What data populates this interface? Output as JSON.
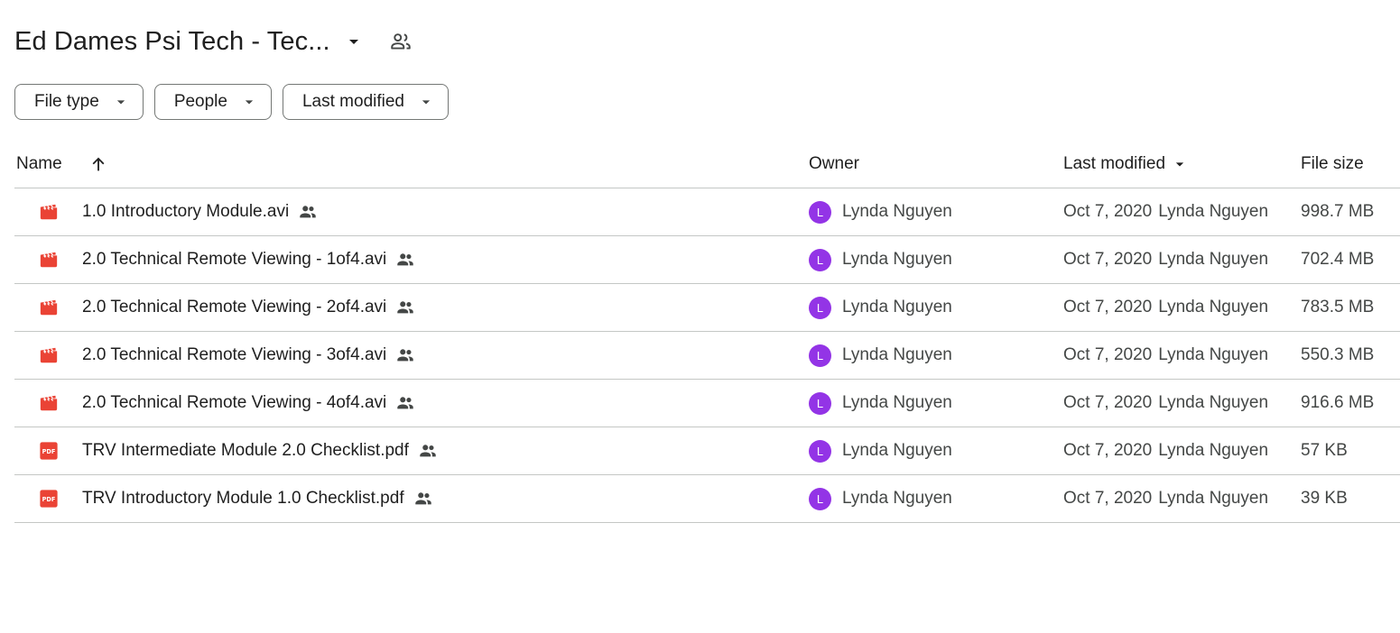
{
  "header": {
    "title": "Ed Dames Psi Tech - Tec...",
    "title_dropdown_icon": "arrow-drop-down-icon",
    "shared_icon": "people-outline-icon"
  },
  "filters": [
    {
      "label": "File type"
    },
    {
      "label": "People"
    },
    {
      "label": "Last modified"
    }
  ],
  "table": {
    "columns": {
      "name": "Name",
      "owner": "Owner",
      "last_modified": "Last modified",
      "file_size": "File size"
    },
    "sort": {
      "name_icon": "arrow-up-icon",
      "modified_icon": "arrow-drop-down-icon"
    },
    "rows": [
      {
        "type": "video",
        "name": "1.0 Introductory Module.avi",
        "owner": "Lynda Nguyen",
        "owner_initial": "L",
        "date": "Oct 7, 2020",
        "modified_by": "Lynda Nguyen",
        "size": "998.7 MB"
      },
      {
        "type": "video",
        "name": "2.0 Technical Remote Viewing - 1of4.avi",
        "owner": "Lynda Nguyen",
        "owner_initial": "L",
        "date": "Oct 7, 2020",
        "modified_by": "Lynda Nguyen",
        "size": "702.4 MB"
      },
      {
        "type": "video",
        "name": "2.0 Technical Remote Viewing - 2of4.avi",
        "owner": "Lynda Nguyen",
        "owner_initial": "L",
        "date": "Oct 7, 2020",
        "modified_by": "Lynda Nguyen",
        "size": "783.5 MB"
      },
      {
        "type": "video",
        "name": "2.0 Technical Remote Viewing - 3of4.avi",
        "owner": "Lynda Nguyen",
        "owner_initial": "L",
        "date": "Oct 7, 2020",
        "modified_by": "Lynda Nguyen",
        "size": "550.3 MB"
      },
      {
        "type": "video",
        "name": "2.0 Technical Remote Viewing - 4of4.avi",
        "owner": "Lynda Nguyen",
        "owner_initial": "L",
        "date": "Oct 7, 2020",
        "modified_by": "Lynda Nguyen",
        "size": "916.6 MB"
      },
      {
        "type": "pdf",
        "name": "TRV Intermediate Module 2.0 Checklist.pdf",
        "owner": "Lynda Nguyen",
        "owner_initial": "L",
        "date": "Oct 7, 2020",
        "modified_by": "Lynda Nguyen",
        "size": "57 KB"
      },
      {
        "type": "pdf",
        "name": "TRV Introductory Module 1.0 Checklist.pdf",
        "owner": "Lynda Nguyen",
        "owner_initial": "L",
        "date": "Oct 7, 2020",
        "modified_by": "Lynda Nguyen",
        "size": "39 KB"
      }
    ]
  },
  "colors": {
    "video_icon": "#ea4335",
    "pdf_icon": "#ea4335",
    "avatar": "#9334e6",
    "divider": "#c4c7c5"
  }
}
